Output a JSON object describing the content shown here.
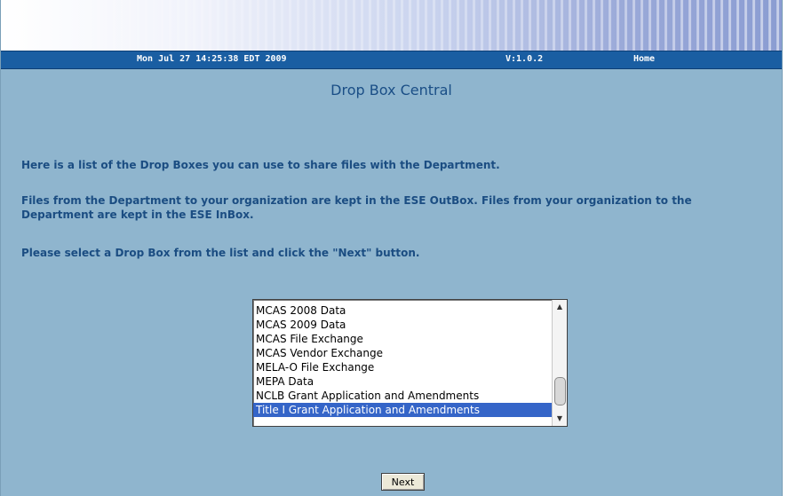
{
  "header": {
    "datetime": "Mon Jul 27 14:25:38 EDT 2009",
    "version": "V:1.0.2",
    "home_link": "Home"
  },
  "main": {
    "title": "Drop Box Central",
    "paragraphs": [
      "Here is a list of the Drop Boxes you can use to share files with the Department.",
      "Files from the Department to your organization are kept in the ESE OutBox. Files from your organization to the Department are kept in the ESE InBox.",
      "Please select a Drop Box from the list and click the \"Next\" button."
    ],
    "dropbox_list": {
      "items": [
        "MCAS 2008 Data",
        "MCAS 2009 Data",
        "MCAS File Exchange",
        "MCAS Vendor Exchange",
        "MELA-O File Exchange",
        "MEPA Data",
        "NCLB Grant Application and Amendments",
        "Title I Grant Application and Amendments"
      ],
      "selected_index": 7
    },
    "next_button": "Next"
  },
  "colors": {
    "background": "#8fb5ce",
    "navbar": "#1a5ea2",
    "text": "#1b4d82",
    "selection": "#3565c8"
  },
  "icons": {
    "scroll_up": "arrow-up-icon",
    "scroll_down": "arrow-down-icon"
  }
}
